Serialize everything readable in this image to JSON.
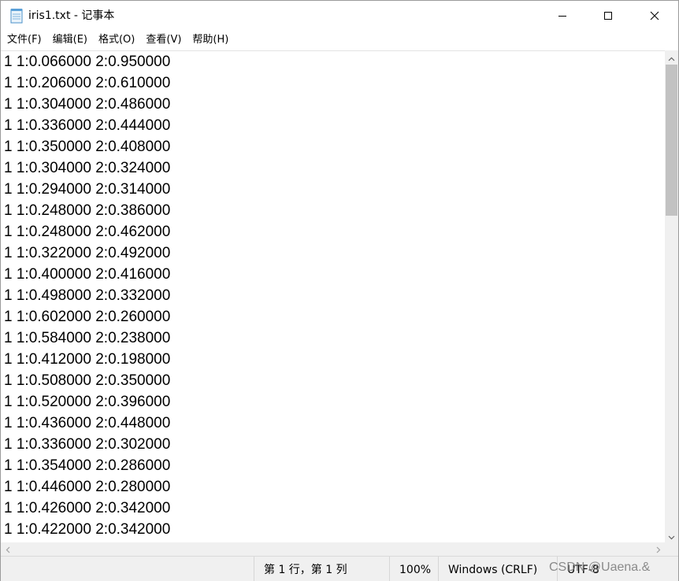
{
  "window": {
    "title": "iris1.txt - 记事本",
    "icon": "notepad-icon",
    "controls": {
      "minimize": "minimize-icon",
      "maximize": "maximize-icon",
      "close": "close-icon"
    }
  },
  "menu": {
    "items": [
      {
        "label": "文件(F)"
      },
      {
        "label": "编辑(E)"
      },
      {
        "label": "格式(O)"
      },
      {
        "label": "查看(V)"
      },
      {
        "label": "帮助(H)"
      }
    ]
  },
  "editor": {
    "lines": [
      "1 1:0.066000 2:0.950000",
      "1 1:0.206000 2:0.610000",
      "1 1:0.304000 2:0.486000",
      "1 1:0.336000 2:0.444000",
      "1 1:0.350000 2:0.408000",
      "1 1:0.304000 2:0.324000",
      "1 1:0.294000 2:0.314000",
      "1 1:0.248000 2:0.386000",
      "1 1:0.248000 2:0.462000",
      "1 1:0.322000 2:0.492000",
      "1 1:0.400000 2:0.416000",
      "1 1:0.498000 2:0.332000",
      "1 1:0.602000 2:0.260000",
      "1 1:0.584000 2:0.238000",
      "1 1:0.412000 2:0.198000",
      "1 1:0.508000 2:0.350000",
      "1 1:0.520000 2:0.396000",
      "1 1:0.436000 2:0.448000",
      "1 1:0.336000 2:0.302000",
      "1 1:0.354000 2:0.286000",
      "1 1:0.446000 2:0.280000",
      "1 1:0.426000 2:0.342000",
      "1 1:0.422000 2:0.342000"
    ]
  },
  "status": {
    "position": "第 1 行，第 1 列",
    "zoom": "100%",
    "line_ending": "Windows (CRLF)",
    "encoding": "UTF-8",
    "watermark": "CSDN @Uaena.&"
  },
  "colors": {
    "chrome_bg": "#f0f0f0",
    "scroll_thumb": "#c2c2c2",
    "text": "#000000"
  }
}
